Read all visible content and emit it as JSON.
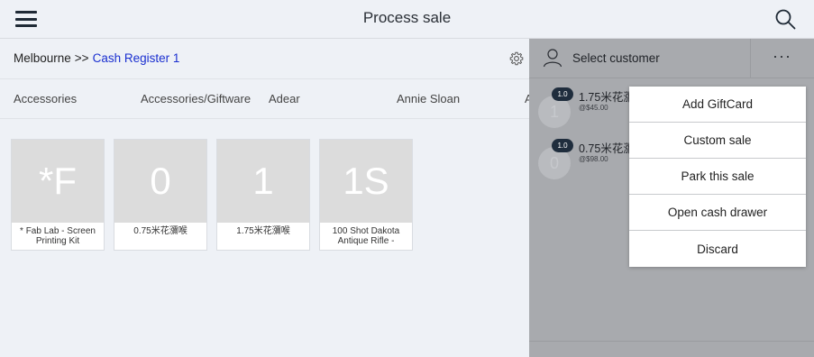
{
  "header": {
    "title": "Process sale"
  },
  "breadcrumb": {
    "location": "Melbourne",
    "separator": ">>",
    "register": "Cash Register 1"
  },
  "categories": [
    "Accessories",
    "Accessories/Giftware",
    "Adear",
    "Annie Sloan",
    "A"
  ],
  "tiles": [
    {
      "initials": "*F",
      "name": "* Fab Lab - Screen Printing Kit"
    },
    {
      "initials": "0",
      "name": "0.75米花瀰喉"
    },
    {
      "initials": "1",
      "name": "1.75米花瀰喉"
    },
    {
      "initials": "1S",
      "name": "100 Shot Dakota Antique Rifle -"
    }
  ],
  "customer": {
    "label": "Select customer",
    "more": "···"
  },
  "sale_lines": [
    {
      "qty": "1.0",
      "avatar": "1",
      "name": "1.75米花瀰",
      "price": "@$45.00"
    },
    {
      "qty": "1.0",
      "avatar": "0",
      "name": "0.75米花瀰",
      "price": "@$98.00"
    }
  ],
  "menu": {
    "items": [
      "Add GiftCard",
      "Custom sale",
      "Park this sale",
      "Open cash drawer",
      "Discard"
    ]
  }
}
